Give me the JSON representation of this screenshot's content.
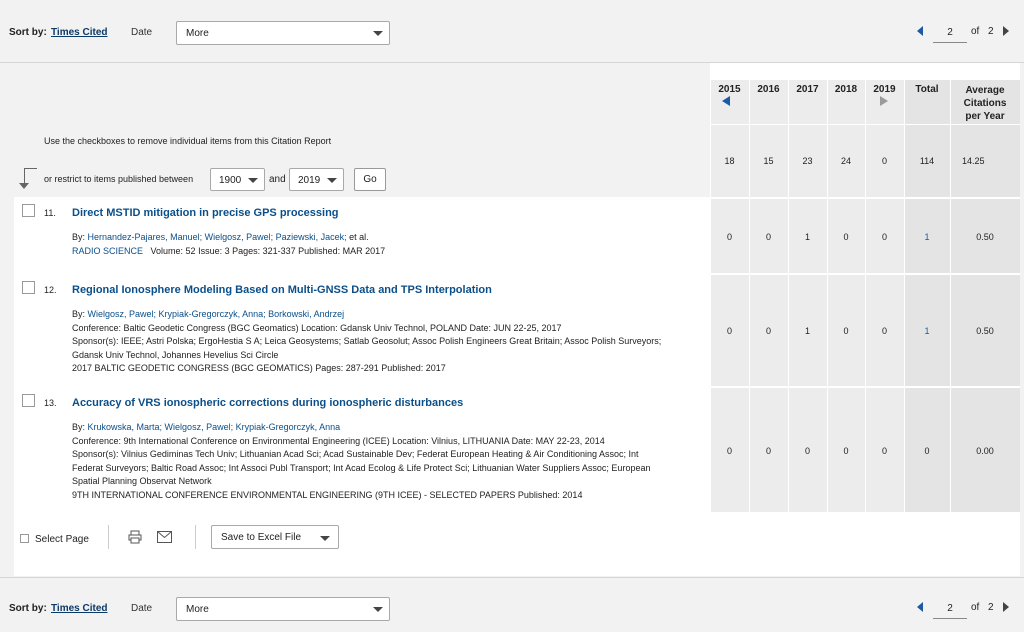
{
  "sort": {
    "label": "Sort by:",
    "active": "Times Cited",
    "date": "Date",
    "more": "More"
  },
  "pager": {
    "current": "2",
    "of_label": "of",
    "total": "2"
  },
  "table": {
    "years": [
      "2015",
      "2016",
      "2017",
      "2018",
      "2019"
    ],
    "total_label": "Total",
    "avg_label_1": "Average",
    "avg_label_2": "Citations",
    "avg_label_3": "per Year",
    "totals": [
      "18",
      "15",
      "23",
      "24",
      "0",
      "114",
      "14.25"
    ]
  },
  "filter": {
    "instruction": "Use the checkboxes to remove individual items from this Citation Report",
    "restrict_label": "or restrict to items published between",
    "from_year": "1900",
    "and_label": "and",
    "to_year": "2019",
    "go_label": "Go"
  },
  "records": [
    {
      "num": "11.",
      "title": "Direct MSTID mitigation in precise GPS processing",
      "by_label": "By:",
      "authors": "Hernandez-Pajares, Manuel; Wielgosz, Pawel; Paziewski, Jacek;",
      "etal": "et al.",
      "source": "RADIO SCIENCE",
      "details": "Volume: 52   Issue: 3   Pages: 321-337   Published: MAR 2017",
      "counts": [
        "0",
        "0",
        "1",
        "0",
        "0",
        "1",
        "0.50"
      ]
    },
    {
      "num": "12.",
      "title": "Regional Ionosphere Modeling Based on Multi-GNSS Data and TPS Interpolation",
      "by_label": "By:",
      "authors": "Wielgosz, Pawel; Krypiak-Gregorczyk, Anna; Borkowski, Andrzej",
      "conference": "Conference: Baltic Geodetic Congress (BGC Geomatics) Location: Gdansk Univ Technol, POLAND Date: JUN 22-25, 2017",
      "sponsor1": "Sponsor(s): IEEE; Astri Polska; ErgoHestia S A; Leica Geosystems; Satlab Geosolut; Assoc Polish Engineers Great Britain; Assoc Polish Surveyors;",
      "sponsor2": "Gdansk Univ Technol, Johannes Hevelius Sci Circle",
      "source": "2017 BALTIC GEODETIC CONGRESS (BGC GEOMATICS)   Pages: 287-291   Published: 2017",
      "counts": [
        "0",
        "0",
        "1",
        "0",
        "0",
        "1",
        "0.50"
      ]
    },
    {
      "num": "13.",
      "title": "Accuracy of VRS ionospheric corrections during ionospheric disturbances",
      "by_label": "By:",
      "authors": "Krukowska, Marta; Wielgosz, Pawel; Krypiak-Gregorczyk, Anna",
      "conference": "Conference: 9th International Conference on Environmental Engineering (ICEE) Location: Vilnius, LITHUANIA Date: MAY 22-23, 2014",
      "sponsor1": "Sponsor(s): Vilnius Gediminas Tech Univ; Lithuanian Acad Sci; Acad Sustainable Dev; Federat European Heating & Air Conditioning Assoc; Int",
      "sponsor2": "Federat Surveyors; Baltic Road Assoc; Int Associ Publ Transport; Int Acad Ecolog & Life Protect Sci; Lithuanian Water Suppliers Assoc; European",
      "sponsor3": "Spatial Planning Observat Network",
      "source": "9TH INTERNATIONAL CONFERENCE ENVIRONMENTAL ENGINEERING (9TH ICEE) - SELECTED PAPERS     Published: 2014",
      "counts": [
        "0",
        "0",
        "0",
        "0",
        "0",
        "0",
        "0.00"
      ]
    }
  ],
  "footer": {
    "select_page": "Select Page",
    "save_label": "Save to Excel File"
  }
}
